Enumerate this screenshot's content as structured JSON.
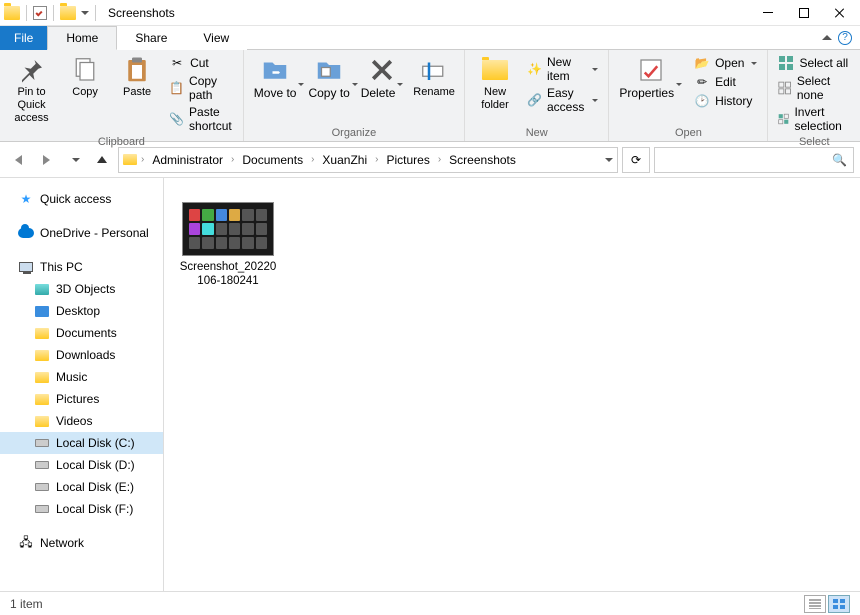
{
  "window": {
    "title": "Screenshots"
  },
  "tabs": {
    "file": "File",
    "home": "Home",
    "share": "Share",
    "view": "View"
  },
  "ribbon": {
    "clipboard": {
      "label": "Clipboard",
      "pin": "Pin to Quick access",
      "copy": "Copy",
      "paste": "Paste",
      "cut": "Cut",
      "copy_path": "Copy path",
      "paste_shortcut": "Paste shortcut"
    },
    "organize": {
      "label": "Organize",
      "move_to": "Move to",
      "copy_to": "Copy to",
      "delete": "Delete",
      "rename": "Rename"
    },
    "new": {
      "label": "New",
      "new_folder": "New folder",
      "new_item": "New item",
      "easy_access": "Easy access"
    },
    "open": {
      "label": "Open",
      "properties": "Properties",
      "open": "Open",
      "edit": "Edit",
      "history": "History"
    },
    "select": {
      "label": "Select",
      "select_all": "Select all",
      "select_none": "Select none",
      "invert": "Invert selection"
    }
  },
  "breadcrumbs": [
    "Administrator",
    "Documents",
    "XuanZhi",
    "Pictures",
    "Screenshots"
  ],
  "search": {
    "placeholder": ""
  },
  "nav": {
    "quick_access": "Quick access",
    "onedrive": "OneDrive - Personal",
    "this_pc": "This PC",
    "items": [
      "3D Objects",
      "Desktop",
      "Documents",
      "Downloads",
      "Music",
      "Pictures",
      "Videos"
    ],
    "drives": [
      "Local Disk (C:)",
      "Local Disk (D:)",
      "Local Disk (E:)",
      "Local Disk (F:)"
    ],
    "network": "Network"
  },
  "files": [
    {
      "name": "Screenshot_20220106-180241"
    }
  ],
  "status": {
    "count": "1 item"
  }
}
